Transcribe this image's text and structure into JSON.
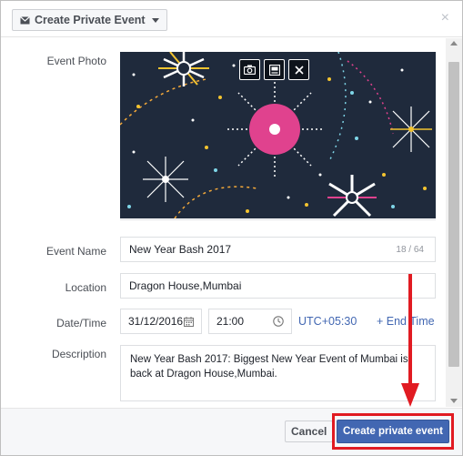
{
  "header": {
    "type_label": "Create Private Event",
    "close_label": "×"
  },
  "form": {
    "photo_label": "Event Photo",
    "name_label": "Event Name",
    "name_value": "New Year Bash 2017",
    "name_counter": "18 / 64",
    "location_label": "Location",
    "location_value": "Dragon House,Mumbai",
    "datetime_label": "Date/Time",
    "date_value": "31/12/2016",
    "time_value": "21:00",
    "timezone": "UTC+05:30",
    "end_time_link": "+ End Time",
    "description_label": "Description",
    "description_value": "New Year Bash 2017: Biggest New Year Event of Mumbai is back at Dragon House,Mumbai."
  },
  "footer": {
    "cancel_label": "Cancel",
    "create_label": "Create private event"
  },
  "colors": {
    "accent": "#4267b2",
    "highlight": "#e11b22",
    "photo_bg": "#1f2a3c",
    "firework_pink": "#e0428e"
  },
  "icons": [
    "envelope-icon",
    "caret-down-icon",
    "close-icon",
    "camera-icon",
    "photo-album-icon",
    "remove-photo-icon",
    "calendar-icon",
    "clock-icon"
  ]
}
